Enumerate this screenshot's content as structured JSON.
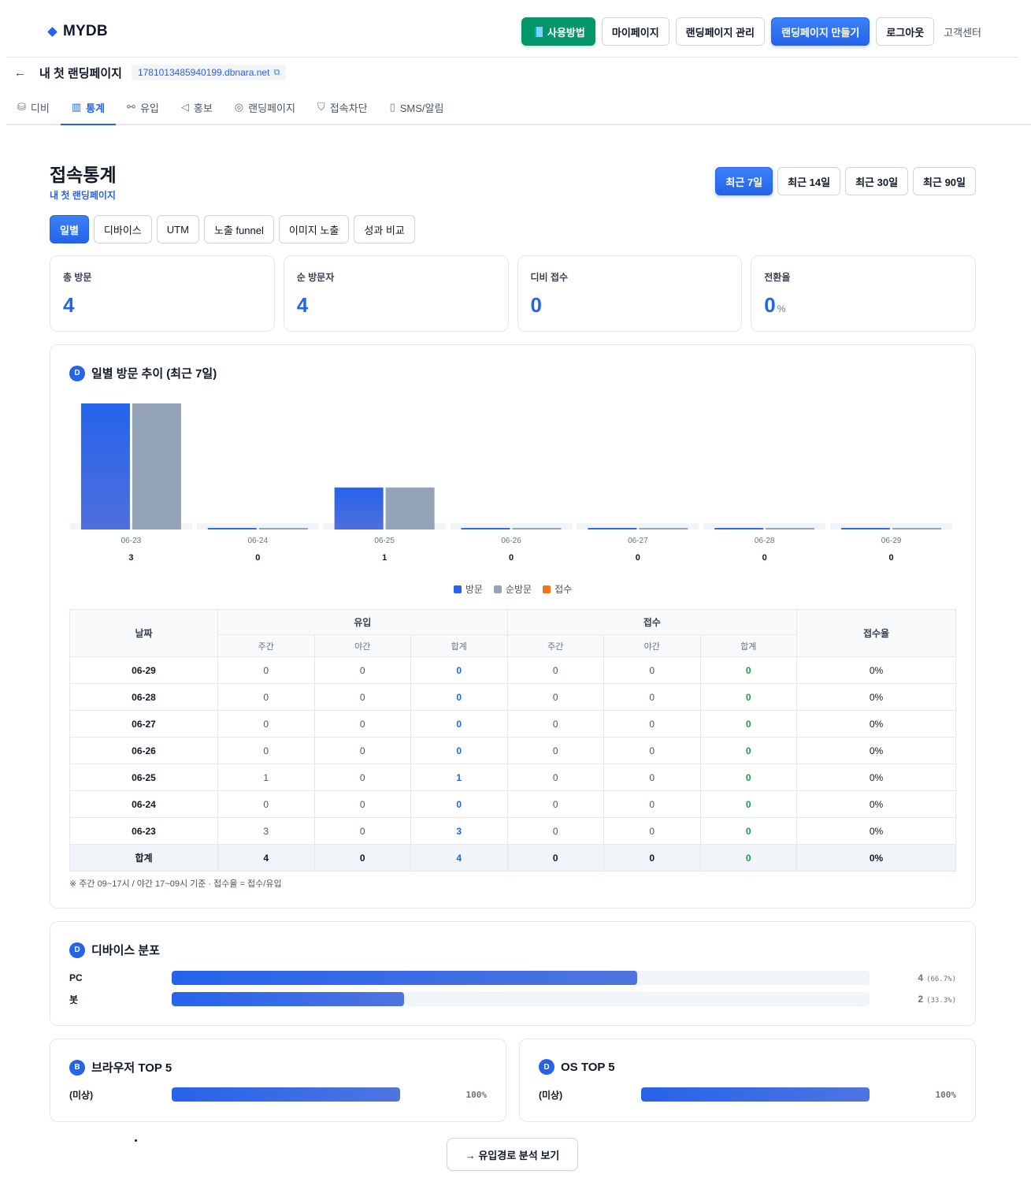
{
  "header": {
    "logo": "MYDB",
    "buttons": {
      "guide": "사용방법",
      "mypage": "마이페이지",
      "manage": "랜딩페이지 관리",
      "create": "랜딩페이지 만들기",
      "logout": "로그아웃",
      "support": "고객센터"
    }
  },
  "subheader": {
    "page_name": "내 첫 랜딩페이지",
    "domain": "1781013485940199.dbnara.net"
  },
  "tabs": [
    {
      "label": "디비",
      "icon": "database-icon"
    },
    {
      "label": "통계",
      "icon": "bar-chart-icon"
    },
    {
      "label": "유입",
      "icon": "flow-icon"
    },
    {
      "label": "홍보",
      "icon": "megaphone-icon"
    },
    {
      "label": "랜딩페이지",
      "icon": "palette-icon"
    },
    {
      "label": "접속차단",
      "icon": "shield-icon"
    },
    {
      "label": "SMS/알림",
      "icon": "phone-icon"
    }
  ],
  "section": {
    "title": "접속통계",
    "subtitle": "내 첫 랜딩페이지",
    "ranges": [
      "최근 7일",
      "최근 14일",
      "최근 30일",
      "최근 90일"
    ],
    "active_range": "최근 7일",
    "subtabs": [
      "일별",
      "디바이스",
      "UTM",
      "노출 funnel",
      "이미지 노출",
      "성과 비교"
    ],
    "active_subtab": "일별"
  },
  "kpis": [
    {
      "label": "총 방문",
      "value": "4",
      "unit": ""
    },
    {
      "label": "순 방문자",
      "value": "4",
      "unit": ""
    },
    {
      "label": "디비 접수",
      "value": "0",
      "unit": ""
    },
    {
      "label": "전환율",
      "value": "0",
      "unit": "%"
    }
  ],
  "daily_card": {
    "badge": "D",
    "title": "일별 방문 추이 (최근 7일)"
  },
  "chart_data": {
    "type": "bar",
    "categories": [
      "06-23",
      "06-24",
      "06-25",
      "06-26",
      "06-27",
      "06-28",
      "06-29"
    ],
    "totals": [
      "3",
      "0",
      "1",
      "0",
      "0",
      "0",
      "0"
    ],
    "series": [
      {
        "name": "방문",
        "values": [
          3,
          0,
          1,
          0,
          0,
          0,
          0
        ],
        "color": "#2563eb"
      },
      {
        "name": "순방문",
        "values": [
          3,
          0,
          1,
          0,
          0,
          0,
          0
        ],
        "color": "#94a3b8"
      },
      {
        "name": "접수",
        "values": [
          0,
          0,
          0,
          0,
          0,
          0,
          0
        ],
        "color": "#f97316"
      }
    ],
    "legend": "bottom-center",
    "ylim": [
      0,
      3
    ]
  },
  "table": {
    "headers": {
      "date": "날짜",
      "inflow": "유입",
      "receipt": "접수",
      "rate": "접수율",
      "day": "주간",
      "night": "야간",
      "sum": "합계"
    },
    "rows": [
      {
        "date": "06-29",
        "in_day": "0",
        "in_night": "0",
        "in_sum": "0",
        "rc_day": "0",
        "rc_night": "0",
        "rc_sum": "0",
        "rate": "0%"
      },
      {
        "date": "06-28",
        "in_day": "0",
        "in_night": "0",
        "in_sum": "0",
        "rc_day": "0",
        "rc_night": "0",
        "rc_sum": "0",
        "rate": "0%"
      },
      {
        "date": "06-27",
        "in_day": "0",
        "in_night": "0",
        "in_sum": "0",
        "rc_day": "0",
        "rc_night": "0",
        "rc_sum": "0",
        "rate": "0%"
      },
      {
        "date": "06-26",
        "in_day": "0",
        "in_night": "0",
        "in_sum": "0",
        "rc_day": "0",
        "rc_night": "0",
        "rc_sum": "0",
        "rate": "0%"
      },
      {
        "date": "06-25",
        "in_day": "1",
        "in_night": "0",
        "in_sum": "1",
        "rc_day": "0",
        "rc_night": "0",
        "rc_sum": "0",
        "rate": "0%"
      },
      {
        "date": "06-24",
        "in_day": "0",
        "in_night": "0",
        "in_sum": "0",
        "rc_day": "0",
        "rc_night": "0",
        "rc_sum": "0",
        "rate": "0%"
      },
      {
        "date": "06-23",
        "in_day": "3",
        "in_night": "0",
        "in_sum": "3",
        "rc_day": "0",
        "rc_night": "0",
        "rc_sum": "0",
        "rate": "0%"
      }
    ],
    "total": {
      "date": "합계",
      "in_day": "4",
      "in_night": "0",
      "in_sum": "4",
      "rc_day": "0",
      "rc_night": "0",
      "rc_sum": "0",
      "rate": "0%"
    },
    "footnote": "※ 주간 09~17시 / 야간 17~09시 기준 · 접수율 = 접수/유입"
  },
  "device_card": {
    "badge": "D",
    "title": "디바이스 분포",
    "rows": [
      {
        "label": "PC",
        "count": "4",
        "pct": "(66.7%)",
        "fraction": 0.667
      },
      {
        "label": "봇",
        "count": "2",
        "pct": "(33.3%)",
        "fraction": 0.333
      }
    ]
  },
  "browser_card": {
    "badge": "B",
    "title": "브라우저 TOP 5",
    "rows": [
      {
        "label": "(미상)",
        "pct": "100%",
        "fraction": 1.0
      }
    ]
  },
  "os_card": {
    "badge": "D",
    "title": "OS TOP 5",
    "rows": [
      {
        "label": "(미상)",
        "pct": "100%",
        "fraction": 1.0
      }
    ]
  },
  "cta": {
    "label": "→ 유입경로 분석 보기"
  }
}
